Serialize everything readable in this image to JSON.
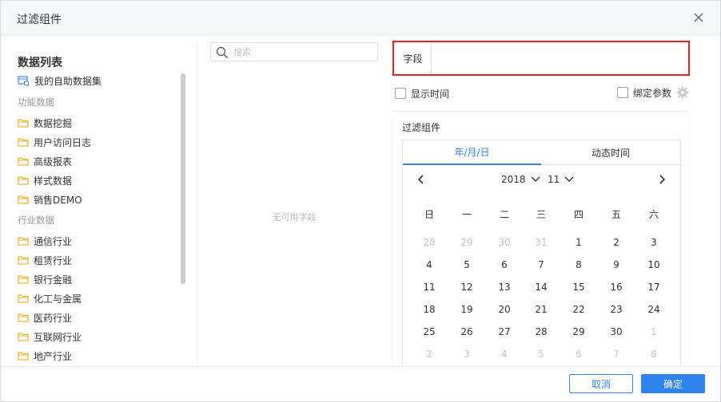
{
  "dialog": {
    "title": "过滤组件",
    "close_icon": "close-icon"
  },
  "left": {
    "title": "数据列表",
    "my_dataset": "我的自助数据集",
    "groups": [
      {
        "label": "功能数据",
        "items": [
          "数据挖掘",
          "用户访问日志",
          "高级报表",
          "样式数据",
          "销售DEMO"
        ]
      },
      {
        "label": "行业数据",
        "items": [
          "通信行业",
          "租赁行业",
          "银行金融",
          "化工与金属",
          "医药行业",
          "互联网行业",
          "地产行业"
        ]
      }
    ],
    "folder_color": "#f0b429",
    "dataset_icon_color": "#3a83e8"
  },
  "middle": {
    "search_placeholder": "搜索",
    "empty_text": "无可用字段"
  },
  "right": {
    "field_label": "字段",
    "show_time_label": "显示时间",
    "bind_param_label": "绑定参数",
    "panel_title": "过滤组件",
    "tabs": [
      "年/月/日",
      "动态时间"
    ],
    "year": "2018",
    "month": "11",
    "weekdays": [
      "日",
      "一",
      "二",
      "三",
      "四",
      "五",
      "六"
    ],
    "weeks": [
      [
        {
          "d": "28",
          "m": "prev"
        },
        {
          "d": "29",
          "m": "prev"
        },
        {
          "d": "30",
          "m": "prev"
        },
        {
          "d": "31",
          "m": "prev"
        },
        {
          "d": "1",
          "m": "cur"
        },
        {
          "d": "2",
          "m": "cur"
        },
        {
          "d": "3",
          "m": "cur"
        }
      ],
      [
        {
          "d": "4",
          "m": "cur"
        },
        {
          "d": "5",
          "m": "cur"
        },
        {
          "d": "6",
          "m": "cur"
        },
        {
          "d": "7",
          "m": "cur"
        },
        {
          "d": "8",
          "m": "cur"
        },
        {
          "d": "9",
          "m": "cur"
        },
        {
          "d": "10",
          "m": "cur"
        }
      ],
      [
        {
          "d": "11",
          "m": "cur"
        },
        {
          "d": "12",
          "m": "cur"
        },
        {
          "d": "13",
          "m": "cur"
        },
        {
          "d": "14",
          "m": "cur"
        },
        {
          "d": "15",
          "m": "cur"
        },
        {
          "d": "16",
          "m": "cur"
        },
        {
          "d": "17",
          "m": "cur"
        }
      ],
      [
        {
          "d": "18",
          "m": "cur"
        },
        {
          "d": "19",
          "m": "cur"
        },
        {
          "d": "20",
          "m": "cur"
        },
        {
          "d": "21",
          "m": "cur"
        },
        {
          "d": "22",
          "m": "cur"
        },
        {
          "d": "23",
          "m": "cur"
        },
        {
          "d": "24",
          "m": "cur"
        }
      ],
      [
        {
          "d": "25",
          "m": "cur"
        },
        {
          "d": "26",
          "m": "cur"
        },
        {
          "d": "27",
          "m": "cur"
        },
        {
          "d": "28",
          "m": "cur"
        },
        {
          "d": "29",
          "m": "cur"
        },
        {
          "d": "30",
          "m": "cur"
        },
        {
          "d": "1",
          "m": "next"
        }
      ],
      [
        {
          "d": "2",
          "m": "next"
        },
        {
          "d": "3",
          "m": "next"
        },
        {
          "d": "4",
          "m": "next"
        },
        {
          "d": "5",
          "m": "next"
        },
        {
          "d": "6",
          "m": "next"
        },
        {
          "d": "7",
          "m": "next"
        },
        {
          "d": "8",
          "m": "next"
        }
      ]
    ],
    "accent_color": "#3a83e8",
    "highlight_color": "#e02424"
  },
  "footer": {
    "cancel_label": "取消",
    "ok_label": "确定"
  }
}
